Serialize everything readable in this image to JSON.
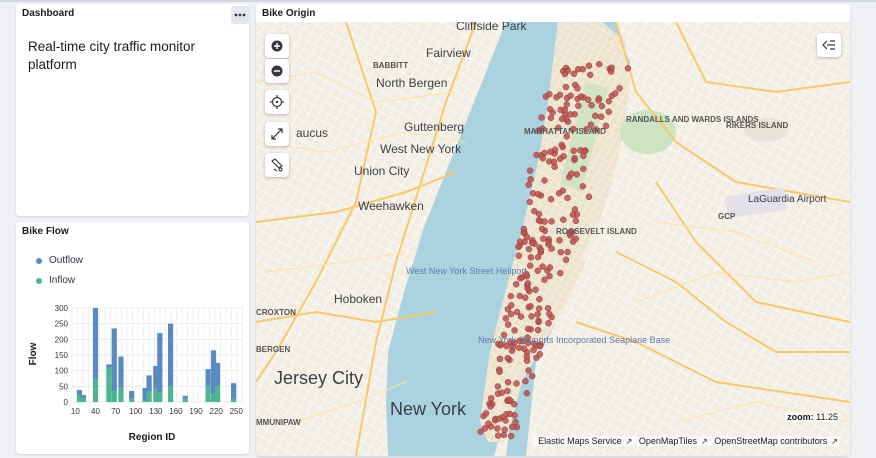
{
  "dashboard": {
    "title": "Dashboard",
    "description": "Real-time city traffic monitor platform",
    "more_icon": "ellipsis-icon"
  },
  "bike_flow": {
    "title": "Bike Flow",
    "legend": [
      {
        "label": "Outflow",
        "color": "#5a8ac2"
      },
      {
        "label": "Inflow",
        "color": "#4fb591"
      }
    ]
  },
  "chart_data": {
    "type": "bar",
    "stacked": true,
    "xlabel": "Region ID",
    "ylabel": "Flow",
    "ylim": [
      0,
      300
    ],
    "yticks": [
      0,
      50,
      100,
      150,
      200,
      250,
      300
    ],
    "xticks": [
      10,
      40,
      70,
      100,
      130,
      160,
      190,
      220,
      250
    ],
    "xlim": [
      5,
      260
    ],
    "grid": true,
    "series": [
      {
        "name": "Outflow",
        "color": "#5a8ac2",
        "points": [
          [
            16,
            18
          ],
          [
            22,
            10
          ],
          [
            40,
            225
          ],
          [
            44,
            0
          ],
          [
            60,
            10
          ],
          [
            68,
            200
          ],
          [
            78,
            100
          ],
          [
            94,
            25
          ],
          [
            114,
            40
          ],
          [
            120,
            50
          ],
          [
            130,
            70
          ],
          [
            136,
            190
          ],
          [
            152,
            200
          ],
          [
            160,
            0
          ],
          [
            174,
            10
          ],
          [
            208,
            55
          ],
          [
            216,
            140
          ],
          [
            222,
            75
          ],
          [
            246,
            50
          ]
        ]
      },
      {
        "name": "Inflow",
        "color": "#4fb591",
        "points": [
          [
            16,
            20
          ],
          [
            22,
            12
          ],
          [
            40,
            75
          ],
          [
            44,
            0
          ],
          [
            60,
            110
          ],
          [
            68,
            35
          ],
          [
            78,
            45
          ],
          [
            94,
            10
          ],
          [
            114,
            5
          ],
          [
            120,
            35
          ],
          [
            130,
            45
          ],
          [
            136,
            30
          ],
          [
            152,
            50
          ],
          [
            160,
            0
          ],
          [
            174,
            10
          ],
          [
            208,
            50
          ],
          [
            216,
            25
          ],
          [
            222,
            50
          ],
          [
            246,
            10
          ]
        ]
      }
    ]
  },
  "map": {
    "title": "Bike Origin",
    "zoom_label": "zoom:",
    "zoom_value": "11.25",
    "attribution": [
      "Elastic Maps Service",
      "OpenMapTiles",
      "OpenStreetMap contributors"
    ],
    "controls": [
      "zoom-in-icon",
      "zoom-out-icon",
      "locate-icon",
      "fit-bounds-icon",
      "measure-icon",
      "layers-toggle-icon"
    ],
    "labels": [
      "Fairview",
      "BABBITT",
      "North Bergen",
      "Guttenberg",
      "aucus",
      "West New York",
      "Union City",
      "Weehawken",
      "West New York Street Heliport",
      "Hoboken",
      "CROXTON",
      "BERGEN",
      "Jersey City",
      "MMUNIPAW",
      "New York",
      "New York Skyports Incorporated Seaplane Base",
      "MANHATTAN ISLAND",
      "RANDALLS AND WARDS ISLANDS",
      "RIKERS ISLAND",
      "LaGuardia Airport",
      "GCP",
      "ROOSEVELT ISLAND",
      "Cliffside Park"
    ]
  }
}
